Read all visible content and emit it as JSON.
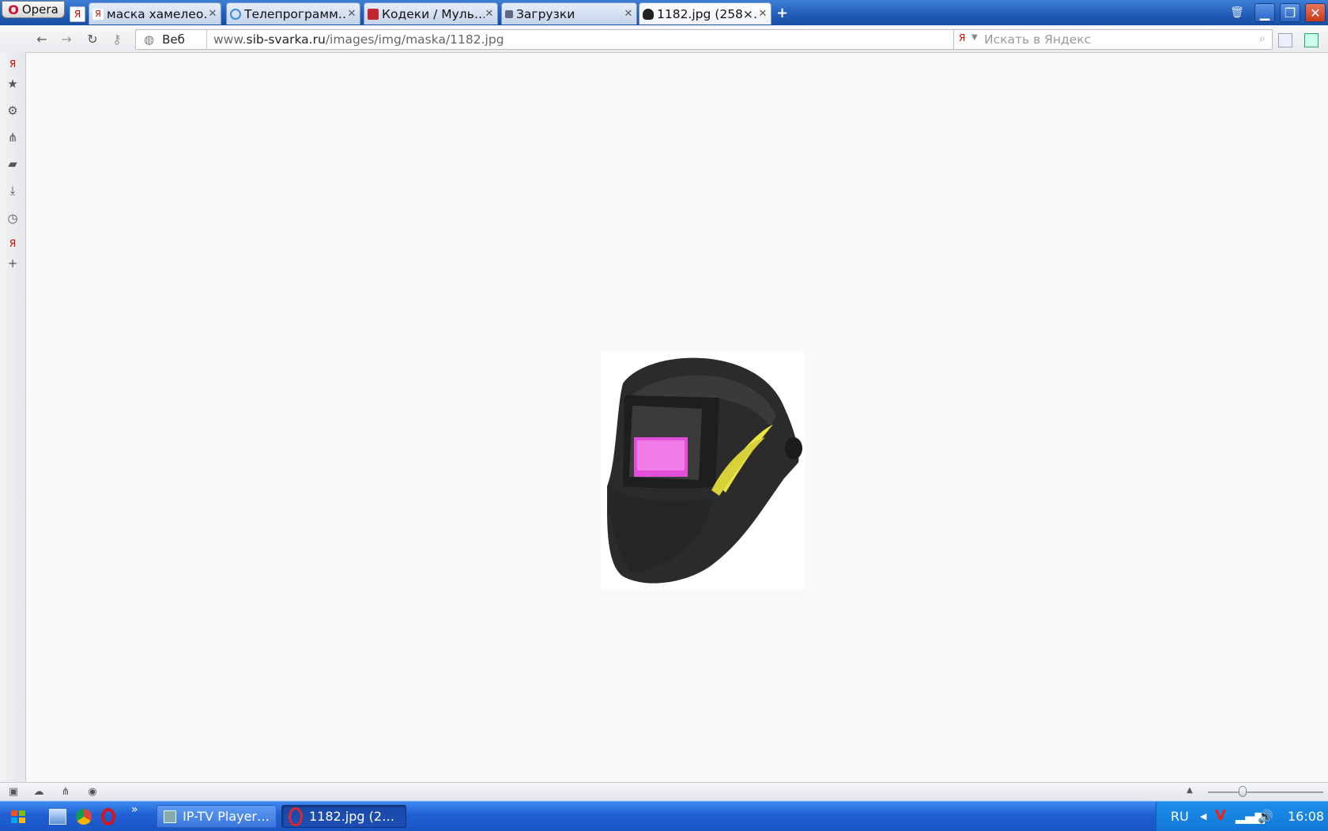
{
  "browser": {
    "menu_label": "Opera",
    "tabs": [
      {
        "label": "маска хамелео…",
        "favicon": "yandex-icon"
      },
      {
        "label": "Телепрограмм…",
        "favicon": "tv-icon"
      },
      {
        "label": "Кодеки / Муль…",
        "favicon": "codec-icon"
      },
      {
        "label": "Загрузки",
        "favicon": "downloads-icon"
      },
      {
        "label": "1182.jpg (258×…",
        "favicon": "helmet-icon",
        "active": true
      }
    ],
    "new_tab_label": "+"
  },
  "navigation": {
    "web_label": "Веб",
    "url_prefix": "www.",
    "url_domain": "sib-svarka.ru",
    "url_path": "/images/img/maska/1182.jpg",
    "search_placeholder": "Искать в Яндекс"
  },
  "sidebar": {
    "icons": [
      "yandex-icon",
      "star-icon",
      "gear-icon",
      "share-icon",
      "note-icon",
      "download-icon",
      "clock-icon",
      "yandex-icon",
      "plus-icon"
    ]
  },
  "content": {
    "image_name": "1182.jpg",
    "image_alt": "welding-helmet",
    "image_width": 258,
    "image_height": 300
  },
  "statusbar": {
    "zoom_fraction": 0.3
  },
  "taskbar": {
    "tasks": [
      {
        "label": "IP-TV Player…",
        "icon": "tv-icon",
        "active": false
      },
      {
        "label": "1182.jpg (2…",
        "icon": "opera-icon",
        "active": true
      }
    ],
    "quicklaunch_more": "»",
    "lang": "RU",
    "clock": "16:08"
  },
  "colors": {
    "accent": "#1f5cb8",
    "taskbar": "#1f5fd3",
    "close": "#c53a1c"
  }
}
